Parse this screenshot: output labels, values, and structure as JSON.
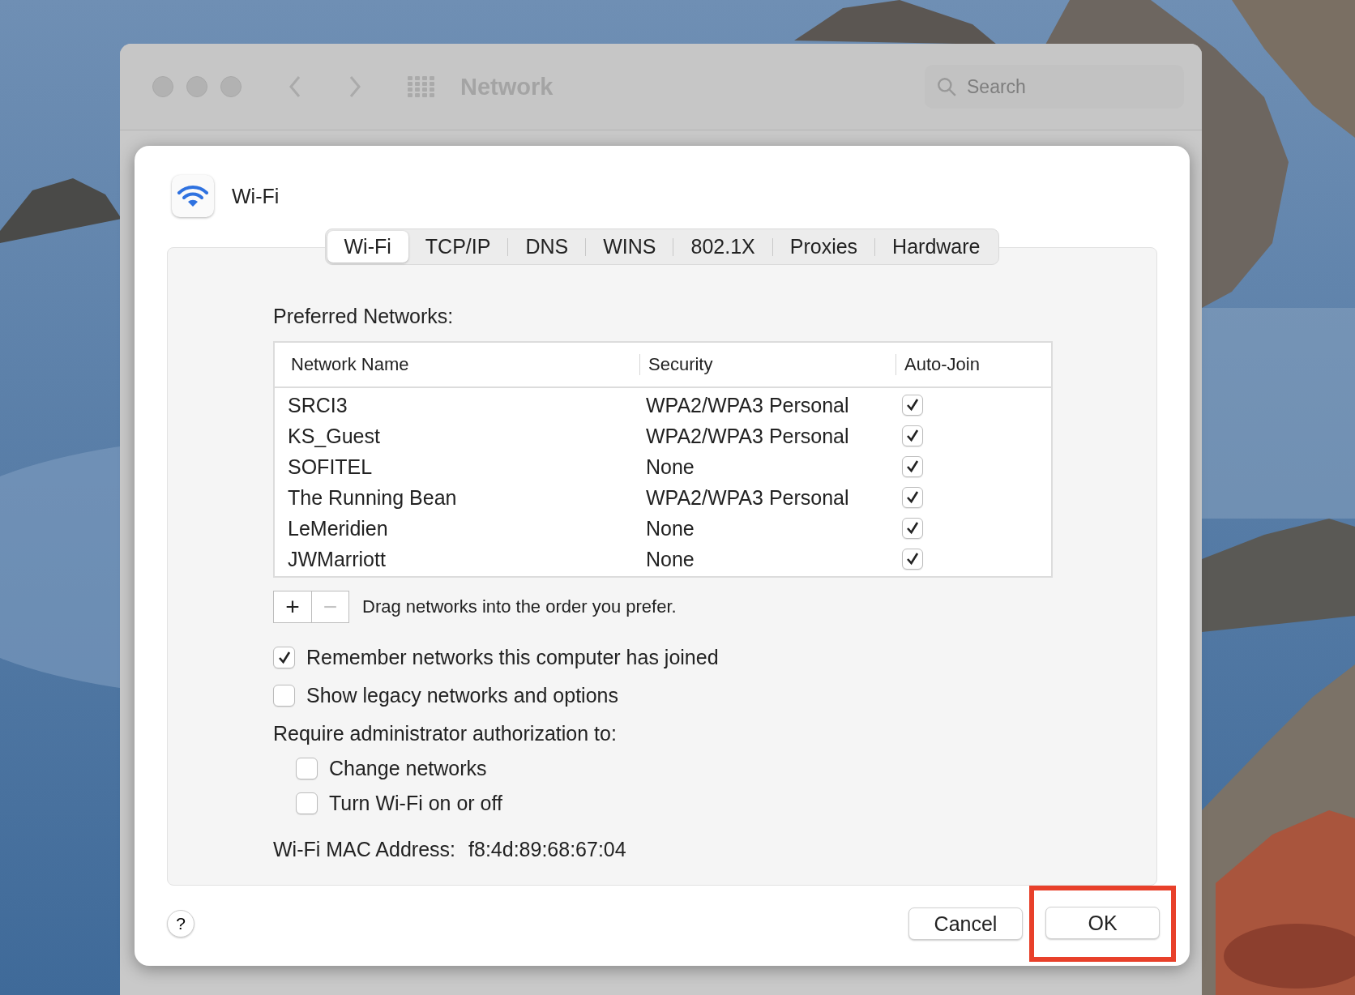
{
  "window": {
    "title": "Network",
    "search": {
      "placeholder": "Search"
    }
  },
  "sheet": {
    "title": "Wi-Fi",
    "tabs": [
      {
        "label": "Wi-Fi",
        "selected": true
      },
      {
        "label": "TCP/IP",
        "selected": false
      },
      {
        "label": "DNS",
        "selected": false
      },
      {
        "label": "WINS",
        "selected": false
      },
      {
        "label": "802.1X",
        "selected": false
      },
      {
        "label": "Proxies",
        "selected": false
      },
      {
        "label": "Hardware",
        "selected": false
      }
    ],
    "preferred_label": "Preferred Networks:",
    "table": {
      "columns": [
        "Network Name",
        "Security",
        "Auto-Join"
      ],
      "rows": [
        {
          "name": "SRCI3",
          "security": "WPA2/WPA3 Personal",
          "auto_join": true
        },
        {
          "name": "KS_Guest",
          "security": "WPA2/WPA3 Personal",
          "auto_join": true
        },
        {
          "name": "SOFITEL",
          "security": "None",
          "auto_join": true
        },
        {
          "name": "The Running Bean",
          "security": "WPA2/WPA3 Personal",
          "auto_join": true
        },
        {
          "name": "LeMeridien",
          "security": "None",
          "auto_join": true
        },
        {
          "name": "JWMarriott",
          "security": "None",
          "auto_join": true
        }
      ]
    },
    "list_buttons": [
      {
        "label": "+",
        "disabled": false
      },
      {
        "label": "−",
        "disabled": true
      }
    ],
    "hint": "Drag networks into the order you prefer.",
    "options": [
      {
        "label": "Remember networks this computer has joined",
        "checked": true
      },
      {
        "label": "Show legacy networks and options",
        "checked": false
      }
    ],
    "admin_label": "Require administrator authorization to:",
    "admin_options": [
      {
        "label": "Change networks",
        "checked": false
      },
      {
        "label": "Turn Wi-Fi on or off",
        "checked": false
      }
    ],
    "mac_label": "Wi-Fi MAC Address:",
    "mac_value": "f8:4d:89:68:67:04",
    "help": "?",
    "buttons": [
      {
        "label": "Cancel",
        "highlighted": false
      },
      {
        "label": "OK",
        "highlighted": true
      }
    ]
  }
}
